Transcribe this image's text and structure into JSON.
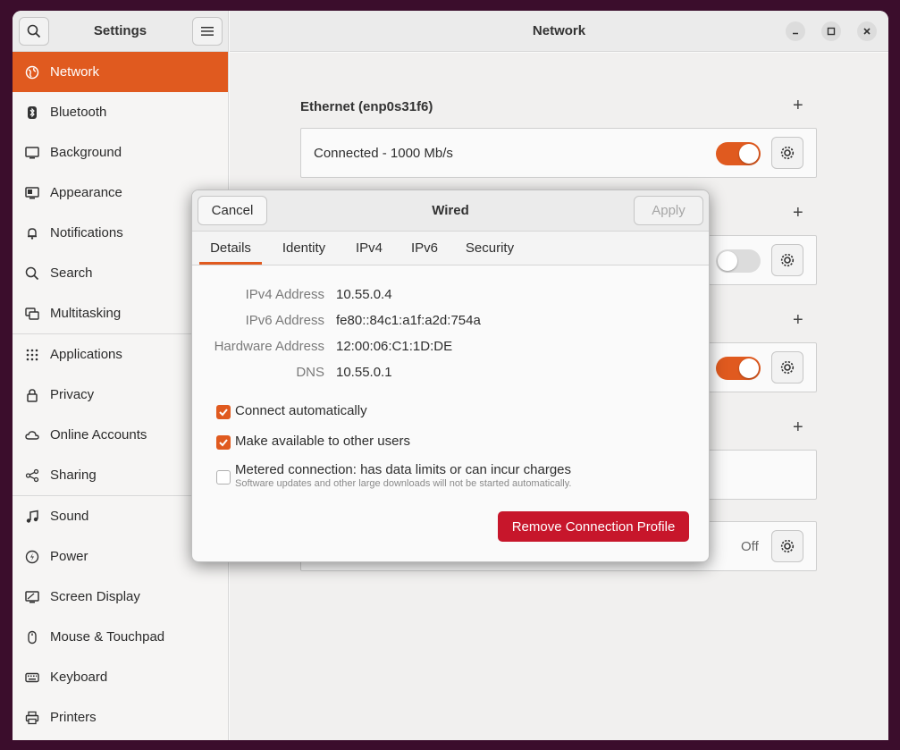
{
  "sidebar": {
    "title": "Settings",
    "items": [
      {
        "label": "Network",
        "icon": "globe-icon"
      },
      {
        "label": "Bluetooth",
        "icon": "bluetooth-icon"
      },
      {
        "label": "Background",
        "icon": "monitor-icon"
      },
      {
        "label": "Appearance",
        "icon": "appearance-icon"
      },
      {
        "label": "Notifications",
        "icon": "bell-icon"
      },
      {
        "label": "Search",
        "icon": "search-icon"
      },
      {
        "label": "Multitasking",
        "icon": "multitasking-icon"
      },
      {
        "label": "Applications",
        "icon": "grid-icon"
      },
      {
        "label": "Privacy",
        "icon": "lock-icon"
      },
      {
        "label": "Online Accounts",
        "icon": "cloud-icon"
      },
      {
        "label": "Sharing",
        "icon": "share-icon"
      },
      {
        "label": "Sound",
        "icon": "music-icon"
      },
      {
        "label": "Power",
        "icon": "power-icon"
      },
      {
        "label": "Screen Display",
        "icon": "display-icon"
      },
      {
        "label": "Mouse & Touchpad",
        "icon": "mouse-icon"
      },
      {
        "label": "Keyboard",
        "icon": "keyboard-icon"
      },
      {
        "label": "Printers",
        "icon": "printer-icon"
      }
    ]
  },
  "main": {
    "title": "Network",
    "ethernet_title": "Ethernet (enp0s31f6)",
    "ethernet_status": "Connected - 1000 Mb/s",
    "off_label": "Off"
  },
  "dialog": {
    "title": "Wired",
    "cancel": "Cancel",
    "apply": "Apply",
    "tabs": [
      "Details",
      "Identity",
      "IPv4",
      "IPv6",
      "Security"
    ],
    "details": {
      "ipv4_key": "IPv4 Address",
      "ipv4_val": "10.55.0.4",
      "ipv6_key": "IPv6 Address",
      "ipv6_val": "fe80::84c1:a1f:a2d:754a",
      "hw_key": "Hardware Address",
      "hw_val": "12:00:06:C1:1D:DE",
      "dns_key": "DNS",
      "dns_val": "10.55.0.1"
    },
    "connect_auto": "Connect automatically",
    "available_users": "Make available to other users",
    "metered": "Metered connection: has data limits or can incur charges",
    "metered_sub": "Software updates and other large downloads will not be started automatically.",
    "remove": "Remove Connection Profile"
  },
  "colors": {
    "accent": "#e05a1f",
    "danger": "#c7162b",
    "desktop": "#3b0d2c"
  }
}
